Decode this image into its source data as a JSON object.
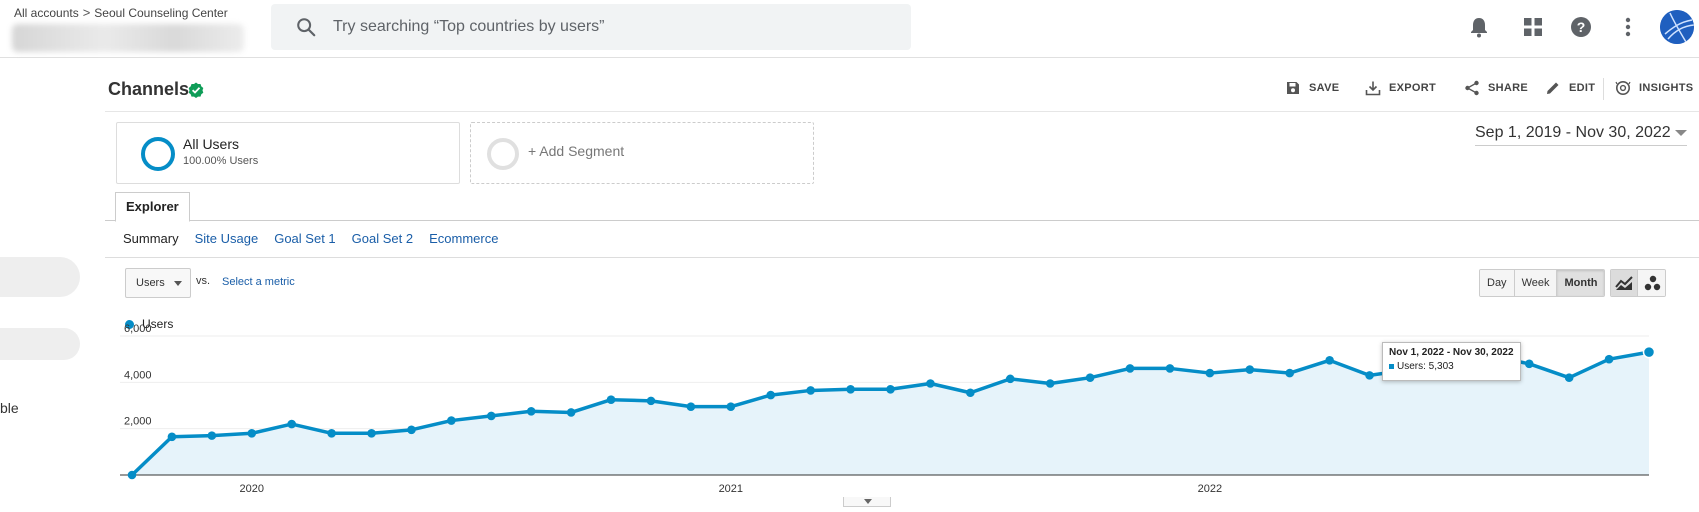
{
  "breadcrumb": {
    "root": "All accounts",
    "separator": ">",
    "account": "Seoul Counseling Center"
  },
  "search": {
    "placeholder": "Try searching “Top countries by users”"
  },
  "header_icons": [
    "bell-icon",
    "apps-grid-icon",
    "help-icon",
    "more-vert-icon"
  ],
  "sidebar": {
    "partial_text": "ble"
  },
  "report": {
    "title": "Channels",
    "actions": [
      {
        "label": "SAVE",
        "icon": "save-icon"
      },
      {
        "label": "EXPORT",
        "icon": "export-icon"
      },
      {
        "label": "SHARE",
        "icon": "share-icon"
      },
      {
        "label": "EDIT",
        "icon": "edit-icon"
      },
      {
        "label": "INSIGHTS",
        "icon": "insights-icon"
      }
    ]
  },
  "segments": {
    "primary": {
      "title": "All Users",
      "subtitle": "100.00% Users"
    },
    "add_label": "+ Add Segment"
  },
  "date_range": "Sep 1, 2019 - Nov 30, 2022",
  "tabs": {
    "explorer": "Explorer"
  },
  "sub_tabs": [
    "Summary",
    "Site Usage",
    "Goal Set 1",
    "Goal Set 2",
    "Ecommerce"
  ],
  "metric": {
    "selected": "Users",
    "vs": "vs.",
    "select_label": "Select a metric"
  },
  "period_buttons": [
    "Day",
    "Week",
    "Month"
  ],
  "active_period": "Month",
  "tooltip": {
    "title": "Nov 1, 2022 - Nov 30, 2022",
    "value": "Users: 5,303"
  },
  "colors": {
    "series": "#058dc7",
    "area": "#e6f3fa",
    "link": "#1a5ea8"
  },
  "chart_data": {
    "type": "area",
    "series": [
      {
        "name": "Users",
        "values": [
          0,
          1650,
          1700,
          1800,
          2200,
          1800,
          1800,
          1950,
          2350,
          2550,
          2750,
          2700,
          3250,
          3200,
          2950,
          2950,
          3450,
          3650,
          3700,
          3700,
          3950,
          3550,
          4150,
          3950,
          4200,
          4600,
          4600,
          4400,
          4550,
          4400,
          4950,
          4300,
          4550,
          4550,
          5150,
          4800,
          4200,
          5000,
          5303
        ]
      }
    ],
    "x_start": "2019-10",
    "x_ticks": [
      "2020",
      "2021",
      "2022"
    ],
    "y_ticks": [
      "2,000",
      "4,000",
      "6,000"
    ],
    "ylim": [
      0,
      6000
    ],
    "legend": "top-left",
    "grid": true
  }
}
